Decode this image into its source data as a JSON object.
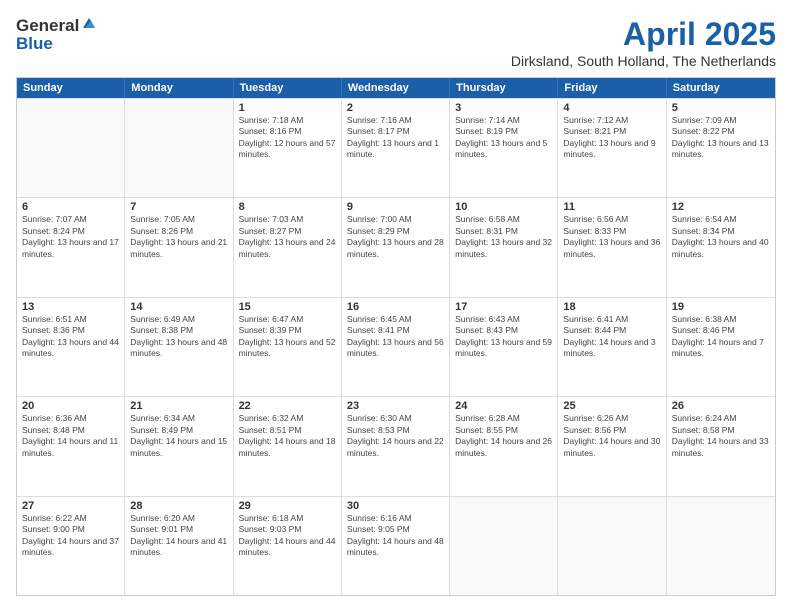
{
  "logo": {
    "line1": "General",
    "line2": "Blue"
  },
  "header": {
    "month": "April 2025",
    "location": "Dirksland, South Holland, The Netherlands"
  },
  "weekdays": [
    "Sunday",
    "Monday",
    "Tuesday",
    "Wednesday",
    "Thursday",
    "Friday",
    "Saturday"
  ],
  "rows": [
    [
      {
        "day": "",
        "text": ""
      },
      {
        "day": "",
        "text": ""
      },
      {
        "day": "1",
        "text": "Sunrise: 7:18 AM\nSunset: 8:16 PM\nDaylight: 12 hours and 57 minutes."
      },
      {
        "day": "2",
        "text": "Sunrise: 7:16 AM\nSunset: 8:17 PM\nDaylight: 13 hours and 1 minute."
      },
      {
        "day": "3",
        "text": "Sunrise: 7:14 AM\nSunset: 8:19 PM\nDaylight: 13 hours and 5 minutes."
      },
      {
        "day": "4",
        "text": "Sunrise: 7:12 AM\nSunset: 8:21 PM\nDaylight: 13 hours and 9 minutes."
      },
      {
        "day": "5",
        "text": "Sunrise: 7:09 AM\nSunset: 8:22 PM\nDaylight: 13 hours and 13 minutes."
      }
    ],
    [
      {
        "day": "6",
        "text": "Sunrise: 7:07 AM\nSunset: 8:24 PM\nDaylight: 13 hours and 17 minutes."
      },
      {
        "day": "7",
        "text": "Sunrise: 7:05 AM\nSunset: 8:26 PM\nDaylight: 13 hours and 21 minutes."
      },
      {
        "day": "8",
        "text": "Sunrise: 7:03 AM\nSunset: 8:27 PM\nDaylight: 13 hours and 24 minutes."
      },
      {
        "day": "9",
        "text": "Sunrise: 7:00 AM\nSunset: 8:29 PM\nDaylight: 13 hours and 28 minutes."
      },
      {
        "day": "10",
        "text": "Sunrise: 6:58 AM\nSunset: 8:31 PM\nDaylight: 13 hours and 32 minutes."
      },
      {
        "day": "11",
        "text": "Sunrise: 6:56 AM\nSunset: 8:33 PM\nDaylight: 13 hours and 36 minutes."
      },
      {
        "day": "12",
        "text": "Sunrise: 6:54 AM\nSunset: 8:34 PM\nDaylight: 13 hours and 40 minutes."
      }
    ],
    [
      {
        "day": "13",
        "text": "Sunrise: 6:51 AM\nSunset: 8:36 PM\nDaylight: 13 hours and 44 minutes."
      },
      {
        "day": "14",
        "text": "Sunrise: 6:49 AM\nSunset: 8:38 PM\nDaylight: 13 hours and 48 minutes."
      },
      {
        "day": "15",
        "text": "Sunrise: 6:47 AM\nSunset: 8:39 PM\nDaylight: 13 hours and 52 minutes."
      },
      {
        "day": "16",
        "text": "Sunrise: 6:45 AM\nSunset: 8:41 PM\nDaylight: 13 hours and 56 minutes."
      },
      {
        "day": "17",
        "text": "Sunrise: 6:43 AM\nSunset: 8:43 PM\nDaylight: 13 hours and 59 minutes."
      },
      {
        "day": "18",
        "text": "Sunrise: 6:41 AM\nSunset: 8:44 PM\nDaylight: 14 hours and 3 minutes."
      },
      {
        "day": "19",
        "text": "Sunrise: 6:38 AM\nSunset: 8:46 PM\nDaylight: 14 hours and 7 minutes."
      }
    ],
    [
      {
        "day": "20",
        "text": "Sunrise: 6:36 AM\nSunset: 8:48 PM\nDaylight: 14 hours and 11 minutes."
      },
      {
        "day": "21",
        "text": "Sunrise: 6:34 AM\nSunset: 8:49 PM\nDaylight: 14 hours and 15 minutes."
      },
      {
        "day": "22",
        "text": "Sunrise: 6:32 AM\nSunset: 8:51 PM\nDaylight: 14 hours and 18 minutes."
      },
      {
        "day": "23",
        "text": "Sunrise: 6:30 AM\nSunset: 8:53 PM\nDaylight: 14 hours and 22 minutes."
      },
      {
        "day": "24",
        "text": "Sunrise: 6:28 AM\nSunset: 8:55 PM\nDaylight: 14 hours and 26 minutes."
      },
      {
        "day": "25",
        "text": "Sunrise: 6:26 AM\nSunset: 8:56 PM\nDaylight: 14 hours and 30 minutes."
      },
      {
        "day": "26",
        "text": "Sunrise: 6:24 AM\nSunset: 8:58 PM\nDaylight: 14 hours and 33 minutes."
      }
    ],
    [
      {
        "day": "27",
        "text": "Sunrise: 6:22 AM\nSunset: 9:00 PM\nDaylight: 14 hours and 37 minutes."
      },
      {
        "day": "28",
        "text": "Sunrise: 6:20 AM\nSunset: 9:01 PM\nDaylight: 14 hours and 41 minutes."
      },
      {
        "day": "29",
        "text": "Sunrise: 6:18 AM\nSunset: 9:03 PM\nDaylight: 14 hours and 44 minutes."
      },
      {
        "day": "30",
        "text": "Sunrise: 6:16 AM\nSunset: 9:05 PM\nDaylight: 14 hours and 48 minutes."
      },
      {
        "day": "",
        "text": ""
      },
      {
        "day": "",
        "text": ""
      },
      {
        "day": "",
        "text": ""
      }
    ]
  ]
}
